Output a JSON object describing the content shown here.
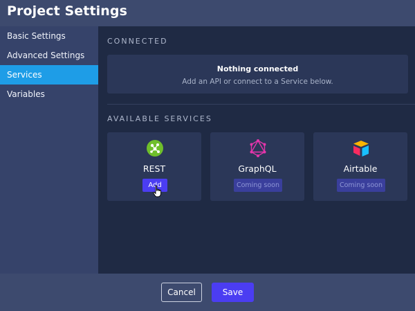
{
  "header": {
    "title": "Project Settings"
  },
  "sidebar": {
    "items": [
      {
        "label": "Basic Settings"
      },
      {
        "label": "Advanced Settings"
      },
      {
        "label": "Services"
      },
      {
        "label": "Variables"
      }
    ],
    "active_index": 2
  },
  "main": {
    "connected_label": "CONNECTED",
    "empty_title": "Nothing connected",
    "empty_subtitle": "Add an API or connect to a Service below.",
    "available_label": "AVAILABLE SERVICES",
    "services": [
      {
        "name": "REST",
        "action": "Add",
        "icon": "rest-icon"
      },
      {
        "name": "GraphQL",
        "action": "Coming soon",
        "icon": "graphql-icon"
      },
      {
        "name": "Airtable",
        "action": "Coming soon",
        "icon": "airtable-icon"
      }
    ]
  },
  "footer": {
    "cancel_label": "Cancel",
    "save_label": "Save"
  },
  "colors": {
    "accent": "#4b3df2",
    "active_nav": "#1e9de7",
    "header": "#3d4a6e",
    "background": "#1f2a44"
  }
}
